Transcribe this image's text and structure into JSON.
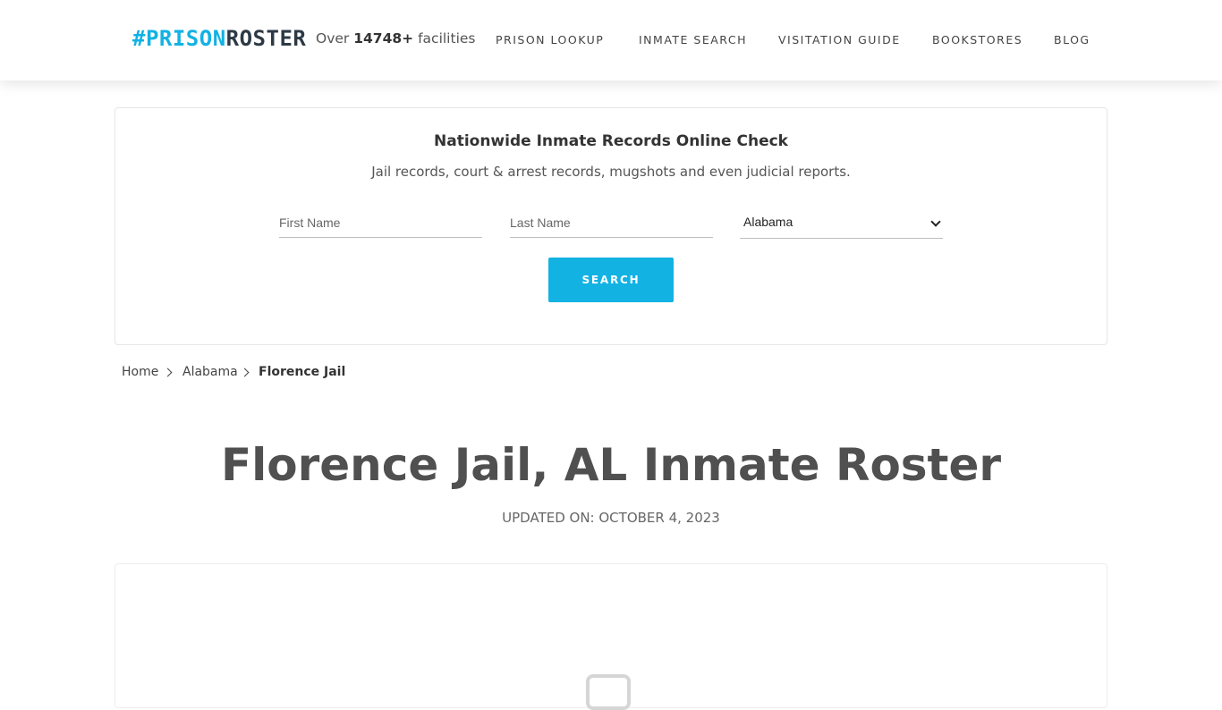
{
  "header": {
    "logo": {
      "prefix": "#PRISON",
      "suffix": "ROSTER"
    },
    "facilities": {
      "before": "Over",
      "count": "14748+",
      "after": "facilities"
    },
    "nav": [
      "PRISON LOOKUP",
      "INMATE SEARCH",
      "VISITATION GUIDE",
      "BOOKSTORES",
      "BLOG"
    ]
  },
  "search": {
    "title": "Nationwide Inmate Records Online Check",
    "subtitle": "Jail records, court & arrest records, mugshots and even judicial reports.",
    "first_name_placeholder": "First Name",
    "last_name_placeholder": "Last Name",
    "state_selected": "Alabama",
    "button_label": "SEARCH"
  },
  "breadcrumb": [
    "Home",
    "Alabama",
    "Florence Jail"
  ],
  "page": {
    "title": "Florence Jail, AL Inmate Roster",
    "updated": "UPDATED ON: OCTOBER 4, 2023"
  },
  "colors": {
    "accent": "#12b2e3",
    "logo_dark": "#2d3a45"
  }
}
